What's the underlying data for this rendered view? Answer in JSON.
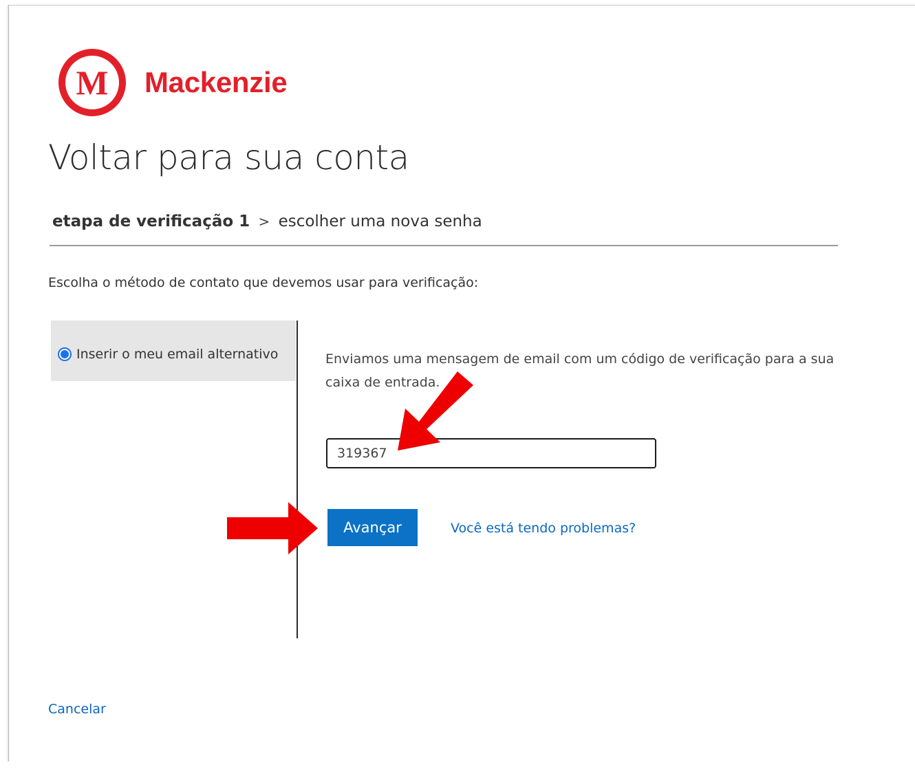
{
  "brand": {
    "name": "Mackenzie",
    "logo_letter": "M",
    "color": "#e2202a"
  },
  "page": {
    "title": "Voltar para sua conta"
  },
  "breadcrumb": {
    "current": "etapa de verificação 1",
    "separator": ">",
    "next": "escolher uma nova senha"
  },
  "instruction": "Escolha o método de contato que devemos usar para verificação:",
  "method": {
    "label": "Inserir o meu email alternativo",
    "selected": true
  },
  "verification": {
    "message": "Enviamos uma mensagem de email com um código de verificação para a sua caixa de entrada.",
    "code_value": "319367"
  },
  "actions": {
    "next_label": "Avançar",
    "help_link": "Você está tendo problemas?",
    "cancel_link": "Cancelar"
  },
  "annotations": {
    "arrow_color": "#ee0000",
    "arrow_icon": "red-arrow-icon"
  },
  "colors": {
    "accent_blue": "#0b72c6",
    "link_blue": "#0b67c2"
  }
}
